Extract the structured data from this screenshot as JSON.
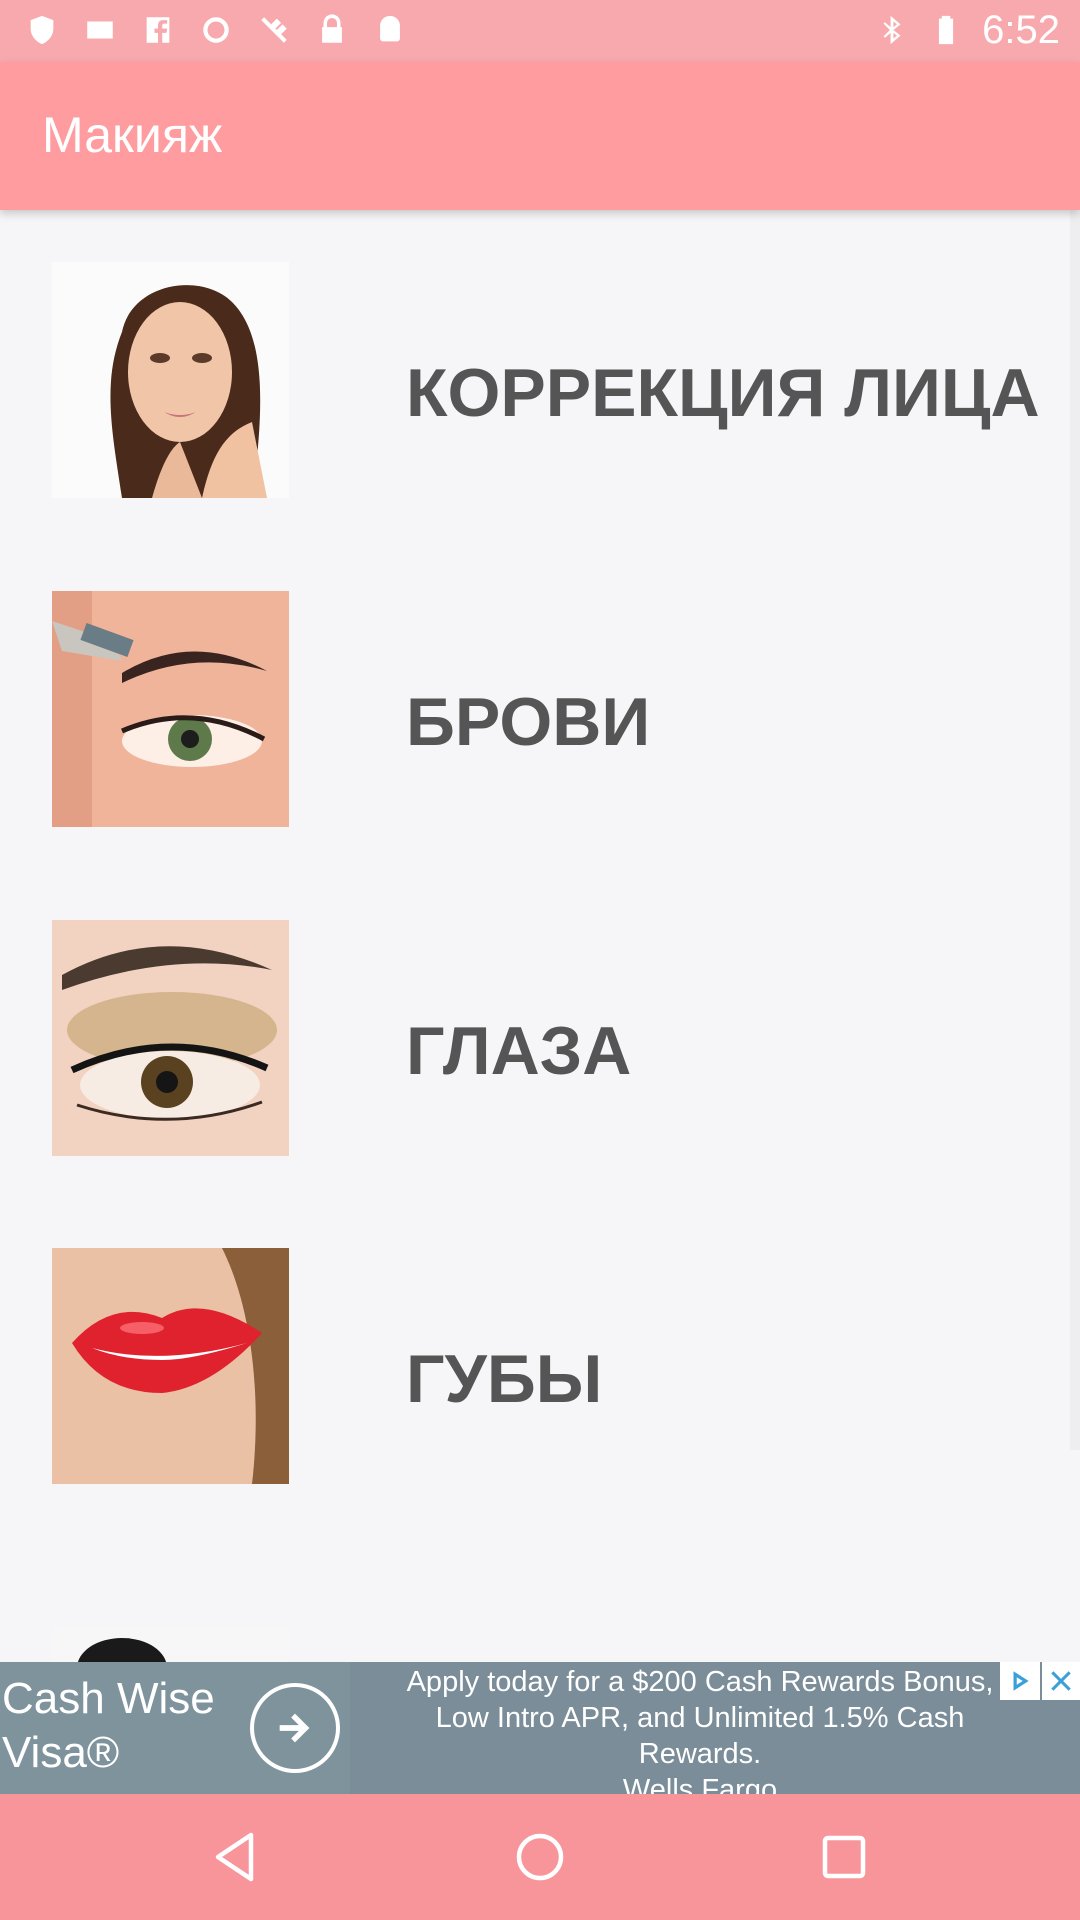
{
  "status_bar": {
    "time": "6:52",
    "left_icons": [
      "shield-icon",
      "message-icon",
      "facebook-icon",
      "ring-icon",
      "no-satellite-icon",
      "lock-icon",
      "android-icon"
    ],
    "right_icons": [
      "bluetooth-icon",
      "battery-saver-icon"
    ]
  },
  "app_bar": {
    "title": "Макияж",
    "color": "#fe9ca0"
  },
  "list": {
    "items": [
      {
        "label": "КОРРЕКЦИЯ ЛИЦА",
        "image": "face-photo"
      },
      {
        "label": "БРОВИ",
        "image": "eyebrow-photo"
      },
      {
        "label": "ГЛАЗА",
        "image": "eye-makeup-photo"
      },
      {
        "label": "ГУБЫ",
        "image": "lips-photo"
      }
    ]
  },
  "ad": {
    "brand": "Cash Wise\nVisa®",
    "text_lines": [
      "Apply today for a $200 Cash Rewards Bonus,",
      "Low Intro APR, and Unlimited 1.5% Cash",
      "Rewards.",
      "Wells Fargo"
    ],
    "background": "#7a8d98"
  },
  "nav_bar": {
    "buttons": [
      "back-icon",
      "home-icon",
      "recents-icon"
    ],
    "color": "#f7959a"
  }
}
